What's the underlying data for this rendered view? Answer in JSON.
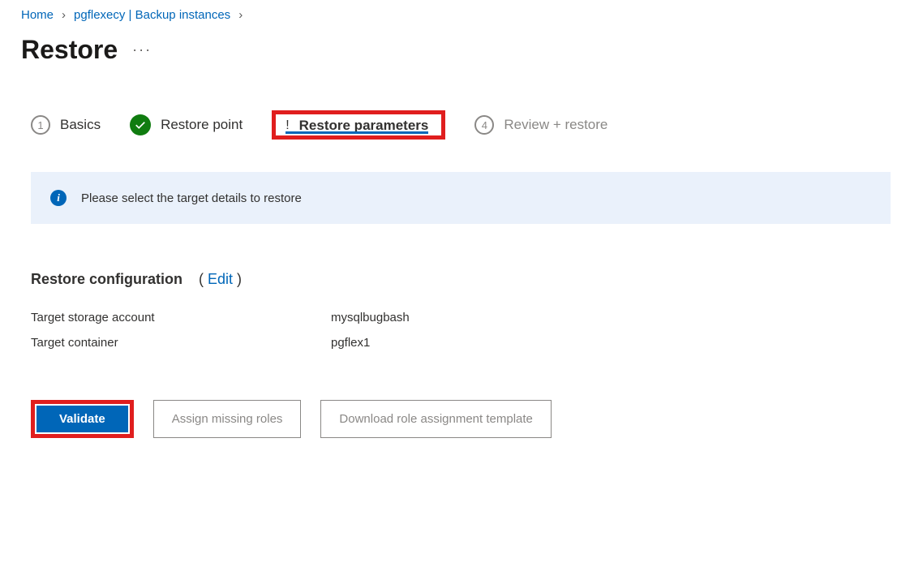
{
  "breadcrumb": {
    "home": "Home",
    "resource": "pgflexecy | Backup instances"
  },
  "page": {
    "title": "Restore",
    "more": "···"
  },
  "steps": {
    "s1": {
      "num": "1",
      "label": "Basics"
    },
    "s2": {
      "label": "Restore point"
    },
    "s3": {
      "label": "Restore parameters"
    },
    "s4": {
      "num": "4",
      "label": "Review + restore"
    }
  },
  "banner": {
    "text": "Please select the target details to restore"
  },
  "config": {
    "heading": "Restore configuration",
    "edit_open": "( ",
    "edit": "Edit",
    "edit_close": " )",
    "k1": "Target storage account",
    "v1": "mysqlbugbash",
    "k2": "Target container",
    "v2": "pgflex1"
  },
  "buttons": {
    "validate": "Validate",
    "assign": "Assign missing roles",
    "download": "Download role assignment template"
  }
}
